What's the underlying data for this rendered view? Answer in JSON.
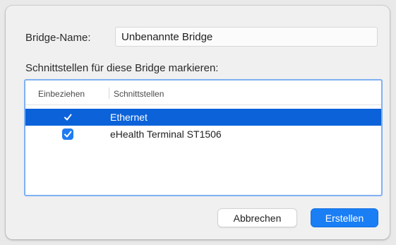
{
  "bridge_name": {
    "label": "Bridge-Name:",
    "value": "Unbenannte Bridge"
  },
  "interfaces": {
    "heading": "Schnittstellen für diese Bridge markieren:",
    "columns": {
      "include": "Einbeziehen",
      "interface": "Schnittstellen"
    },
    "rows": [
      {
        "name": "Ethernet",
        "checked": true,
        "selected": true
      },
      {
        "name": "eHealth Terminal ST1506",
        "checked": true,
        "selected": false
      }
    ]
  },
  "buttons": {
    "cancel": "Abbrechen",
    "create": "Erstellen"
  },
  "colors": {
    "accent": "#1a7ef5",
    "selection": "#0b62d9"
  }
}
